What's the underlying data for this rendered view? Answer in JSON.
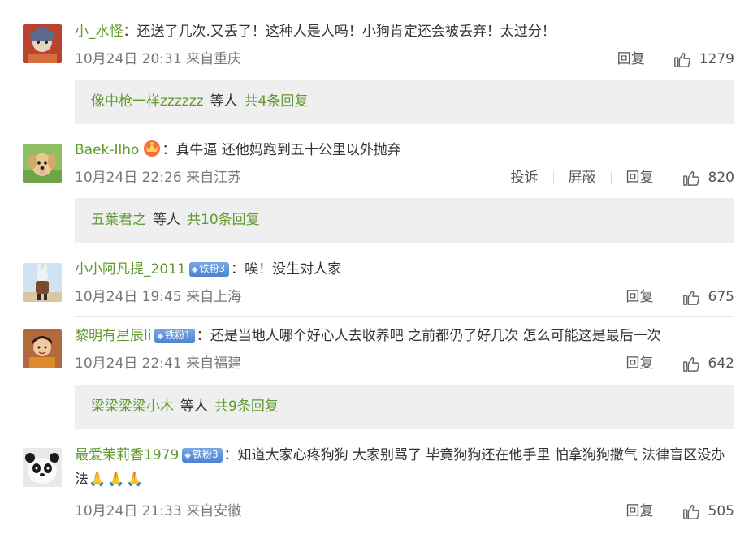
{
  "comments": [
    {
      "username": "小_水怪",
      "text": "：还送了几次.又丢了！这种人是人吗！小狗肯定还会被丢弃！太过分！",
      "time": "10月24日 20:31",
      "location": "来自重庆",
      "actions": [
        "回复"
      ],
      "likes": "1279",
      "replies": {
        "user": "像中枪一样zzzzzz",
        "mid": "等人",
        "total": "共4条回复"
      }
    },
    {
      "username": "Baek-Ilho",
      "text": "：真牛逼 还他妈跑到五十公里以外抛弃",
      "time": "10月24日 22:26",
      "location": "来自江苏",
      "actions": [
        "投诉",
        "屏蔽",
        "回复"
      ],
      "likes": "820",
      "replies": {
        "user": "五葉君之",
        "mid": "等人",
        "total": "共10条回复"
      }
    },
    {
      "username": "小小阿凡提_2011",
      "badge": "铁粉3",
      "text": "：唉！没生对人家",
      "time": "10月24日 19:45",
      "location": "来自上海",
      "actions": [
        "回复"
      ],
      "likes": "675"
    },
    {
      "username": "黎明有星辰li",
      "badge": "铁粉1",
      "text": "：还是当地人哪个好心人去收养吧 之前都仍了好几次 怎么可能这是最后一次",
      "time": "10月24日 22:41",
      "location": "来自福建",
      "actions": [
        "回复"
      ],
      "likes": "642",
      "replies": {
        "user": "梁梁梁梁小木",
        "mid": "等人",
        "total": "共9条回复"
      }
    },
    {
      "username": "最爱茉莉香1979",
      "badge": "铁粉3",
      "text": "：知道大家心疼狗狗 大家别骂了 毕竟狗狗还在他手里 怕拿狗狗撒气 法律盲区没办法",
      "emoji": "🙏🙏🙏",
      "time": "10月24日 21:33",
      "location": "来自安徽",
      "actions": [
        "回复"
      ],
      "likes": "505"
    }
  ],
  "colors": {
    "username": "#5e9a2c",
    "text": "#333333",
    "meta": "#777777",
    "reply_bg": "#efefef",
    "badge": "#4d83cf"
  },
  "icons": [
    "thumbs-up-icon",
    "vip-crown-icon",
    "diamond-icon",
    "pray-emoji"
  ]
}
